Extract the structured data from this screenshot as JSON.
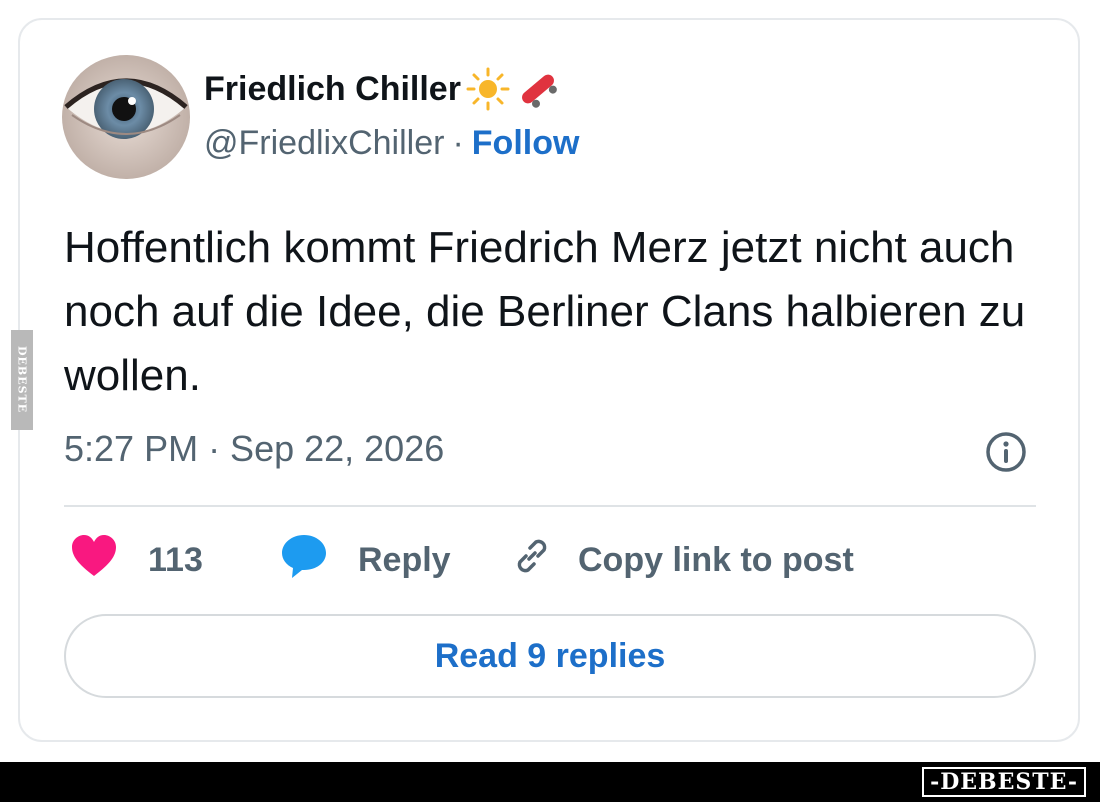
{
  "author": {
    "display_name": "Friedlich Chiller",
    "emojis": [
      "sun-emoji",
      "skateboard-emoji"
    ],
    "handle": "@FriedlixChiller",
    "separator": "·",
    "follow_label": "Follow",
    "avatar": "eye-avatar"
  },
  "tweet": {
    "text": "Hoffentlich kommt Friedrich Merz jetzt nicht auch noch auf die Idee, die Berliner Clans halbieren zu wollen.",
    "timestamp": "5:27 PM · Sep 22, 2026"
  },
  "actions": {
    "like_count": "113",
    "reply_label": "Reply",
    "copy_label": "Copy link to post"
  },
  "read_replies_label": "Read 9 replies",
  "watermark": {
    "side": "DEBESTE",
    "bottom": "-DEBESTE-"
  },
  "colors": {
    "link": "#1d6fc9",
    "heart": "#f91880",
    "reply_bubble": "#1d9bf0",
    "text": "#0f1419",
    "muted": "#536471"
  }
}
